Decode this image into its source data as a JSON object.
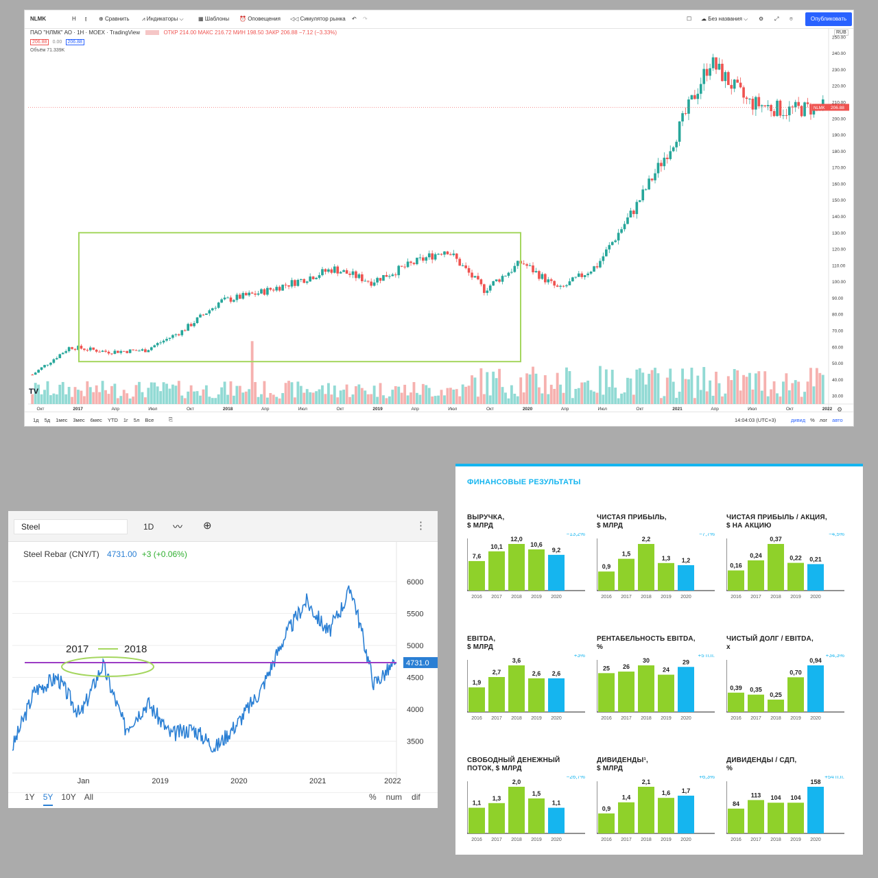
{
  "tradingview": {
    "symbol": "NLMK",
    "interval": "Н",
    "toolbar": {
      "compare": "Сравнить",
      "indicators": "Индикаторы",
      "templates": "Шаблоны",
      "alerts": "Оповещения",
      "replay": "Симулятор рынка",
      "layout_name": "Без названия",
      "publish": "Опубликовать"
    },
    "legend": {
      "title": "ПАО \"НЛМК\" АО · 1Н · MOEX · TradingView",
      "ohlc": "ОТКР 214.00 МАКС 216.72 МИН 198.50 ЗАКР 206.88 −7.12 (−3.33%)",
      "bid": "206.88",
      "spread": "0.00",
      "ask": "206.88",
      "volume": "Объём  71.339K"
    },
    "currency": "RUB",
    "price_tag": "206.88",
    "price_tag_label": "NLMK",
    "y_ticks": [
      "250.00",
      "240.00",
      "230.00",
      "220.00",
      "210.00",
      "200.00",
      "190.00",
      "180.00",
      "170.00",
      "160.00",
      "150.00",
      "140.00",
      "130.00",
      "120.00",
      "110.00",
      "100.00",
      "90.00",
      "80.00",
      "70.00",
      "60.00",
      "50.00",
      "40.00",
      "30.00"
    ],
    "x_ticks": [
      "Окт",
      "2017",
      "Апр",
      "Июл",
      "Окт",
      "2018",
      "Апр",
      "Июл",
      "Окт",
      "2019",
      "Апр",
      "Июл",
      "Окт",
      "2020",
      "Апр",
      "Июл",
      "Окт",
      "2021",
      "Апр",
      "Июл",
      "Окт",
      "2022"
    ],
    "ranges": [
      "1д",
      "5д",
      "1мес",
      "3мес",
      "6мес",
      "YTD",
      "1г",
      "5л",
      "Все"
    ],
    "time": "14:04:03 (UTC+3)",
    "bottom_right": [
      "дивид",
      "%",
      "лог",
      "авто"
    ],
    "colors": {
      "up": "#26a69a",
      "down": "#ef5350",
      "box": "#a4d65e"
    }
  },
  "steel": {
    "search": "Steel",
    "interval": "1D",
    "name": "Steel Rebar (CNY/T)",
    "price": "4731.00",
    "change": "+3 (+0.06%)",
    "price_tag": "4731.0",
    "annotation_left": "2017",
    "annotation_right": "2018",
    "y_ticks": [
      "6000",
      "5500",
      "5000",
      "4500",
      "4000",
      "3500"
    ],
    "x_ticks": [
      "Jan",
      "2019",
      "2020",
      "2021",
      "2022"
    ],
    "ranges": [
      "1Y",
      "5Y",
      "10Y",
      "All"
    ],
    "active_range": "5Y",
    "modes": [
      "%",
      "num",
      "dif"
    ],
    "colors": {
      "line": "#2a7fd4",
      "level": "#9b3bc4",
      "ellipse": "#a4d65e"
    }
  },
  "financials": {
    "heading": "ФИНАНСОВЫЕ РЕЗУЛЬТАТЫ",
    "colors": {
      "bar": "#8fd12a",
      "bar_last": "#15b5ef",
      "heading": "#15b5ef"
    },
    "charts": [
      {
        "title1": "ВЫРУЧКА,",
        "title2": "$ МЛРД",
        "change": "−13,2%",
        "years": [
          "2016",
          "2017",
          "2018",
          "2019",
          "2020"
        ],
        "values": [
          7.6,
          10.1,
          12.0,
          10.6,
          9.2
        ],
        "labels": [
          "7,6",
          "10,1",
          "12,0",
          "10,6",
          "9,2"
        ]
      },
      {
        "title1": "ЧИСТАЯ ПРИБЫЛЬ,",
        "title2": "$ МЛРД",
        "change": "−7,7%",
        "years": [
          "2016",
          "2017",
          "2018",
          "2019",
          "2020"
        ],
        "values": [
          0.9,
          1.5,
          2.2,
          1.3,
          1.2
        ],
        "labels": [
          "0,9",
          "1,5",
          "2,2",
          "1,3",
          "1,2"
        ]
      },
      {
        "title1": "ЧИСТАЯ ПРИБЫЛЬ / АКЦИЯ,",
        "title2": "$ НА АКЦИЮ",
        "change": "−4,5%",
        "years": [
          "2016",
          "2017",
          "2018",
          "2019",
          "2020"
        ],
        "values": [
          0.16,
          0.24,
          0.37,
          0.22,
          0.21
        ],
        "labels": [
          "0,16",
          "0,24",
          "0,37",
          "0,22",
          "0,21"
        ]
      },
      {
        "title1": "EBITDA,",
        "title2": "$ МЛРД",
        "change": "+3%",
        "years": [
          "2016",
          "2017",
          "2018",
          "2019",
          "2020"
        ],
        "values": [
          1.9,
          2.7,
          3.6,
          2.6,
          2.6
        ],
        "labels": [
          "1,9",
          "2,7",
          "3,6",
          "2,6",
          "2,6"
        ]
      },
      {
        "title1": "РЕНТАБЕЛЬНОСТЬ EBITDA,",
        "title2": "%",
        "change": "+5 п.п.",
        "years": [
          "2016",
          "2017",
          "2018",
          "2019",
          "2020"
        ],
        "values": [
          25,
          26,
          30,
          24,
          29
        ],
        "labels": [
          "25",
          "26",
          "30",
          "24",
          "29"
        ]
      },
      {
        "title1": "ЧИСТЫЙ ДОЛГ / EBITDA,",
        "title2": "x",
        "change": "+34,3%",
        "years": [
          "2016",
          "2017",
          "2018",
          "2019",
          "2020"
        ],
        "values": [
          0.39,
          0.35,
          0.25,
          0.7,
          0.94
        ],
        "labels": [
          "0,39",
          "0,35",
          "0,25",
          "0,70",
          "0,94"
        ]
      },
      {
        "title1": "СВОБОДНЫЙ ДЕНЕЖНЫЙ",
        "title2": "ПОТОК, $ МЛРД",
        "change": "−26,7%",
        "years": [
          "2016",
          "2017",
          "2018",
          "2019",
          "2020"
        ],
        "values": [
          1.1,
          1.3,
          2.0,
          1.5,
          1.1
        ],
        "labels": [
          "1,1",
          "1,3",
          "2,0",
          "1,5",
          "1,1"
        ]
      },
      {
        "title1": "ДИВИДЕНДЫ¹,",
        "title2": "$ МЛРД",
        "change": "+6,3%",
        "years": [
          "2016",
          "2017",
          "2018",
          "2019",
          "2020"
        ],
        "values": [
          0.9,
          1.4,
          2.1,
          1.6,
          1.7
        ],
        "labels": [
          "0,9",
          "1,4",
          "2,1",
          "1,6",
          "1,7"
        ]
      },
      {
        "title1": "ДИВИДЕНДЫ / СДП,",
        "title2": "%",
        "change": "+54 п.п.",
        "years": [
          "2016",
          "2017",
          "2018",
          "2019",
          "2020"
        ],
        "values": [
          84,
          113,
          104,
          104,
          158
        ],
        "labels": [
          "84",
          "113",
          "104",
          "104",
          "158"
        ]
      }
    ]
  },
  "chart_data": [
    {
      "type": "line",
      "title": "ПАО \"НЛМК\" АО · 1Н · MOEX",
      "ylabel": "RUB",
      "ylim": [
        25,
        255
      ],
      "x": [
        "2016-10",
        "2017-01",
        "2017-04",
        "2017-07",
        "2017-10",
        "2018-01",
        "2018-04",
        "2018-07",
        "2018-10",
        "2019-01",
        "2019-04",
        "2019-07",
        "2019-10",
        "2020-01",
        "2020-04",
        "2020-07",
        "2020-10",
        "2021-01",
        "2021-04",
        "2021-07",
        "2021-10",
        "2022-01"
      ],
      "series": [
        {
          "values": [
            43,
            60,
            57,
            58,
            70,
            88,
            93,
            100,
            108,
            100,
            110,
            120,
            95,
            112,
            95,
            110,
            145,
            185,
            235,
            210,
            205,
            206.88
          ]
        }
      ]
    },
    {
      "type": "line",
      "title": "Steel Rebar (CNY/T)",
      "ylim": [
        3000,
        6300
      ],
      "x": [
        "2017-06",
        "2017-09",
        "2018-01",
        "2018-05",
        "2018-10",
        "2019-01",
        "2019-06",
        "2019-09",
        "2020-01",
        "2020-04",
        "2020-08",
        "2020-12",
        "2021-03",
        "2021-05",
        "2021-07",
        "2021-09",
        "2021-11",
        "2022-01"
      ],
      "series": [
        {
          "values": [
            3400,
            4300,
            4500,
            3900,
            4700,
            3700,
            4100,
            3600,
            3700,
            3400,
            3800,
            4300,
            5100,
            5700,
            5200,
            5900,
            4400,
            4731
          ]
        }
      ]
    }
  ]
}
